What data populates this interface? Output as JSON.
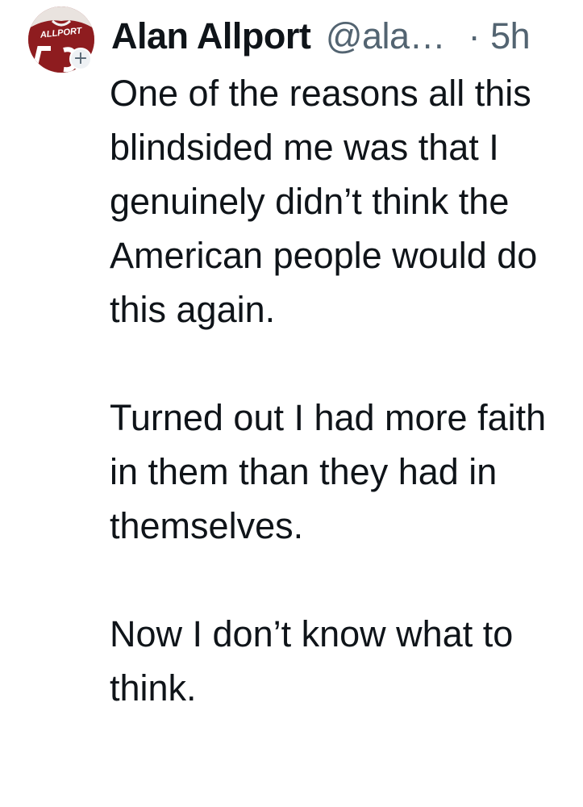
{
  "author": {
    "display_name": "Alan Allport",
    "handle": "@ala…",
    "avatar_text": "ALLPORT"
  },
  "meta": {
    "separator": "·",
    "timestamp": "5h"
  },
  "follow_badge": {
    "label": "+"
  },
  "body": {
    "paragraphs": [
      "One of the reasons all this blindsided me was that I genuinely didn’t think the American people would do this again.",
      "Turned out I had more faith in them than they had in themselves.",
      "Now I don’t know what to think."
    ]
  },
  "colors": {
    "text_primary": "#0f1419",
    "text_secondary": "#536471",
    "avatar_jersey": "#8e1c1f"
  }
}
